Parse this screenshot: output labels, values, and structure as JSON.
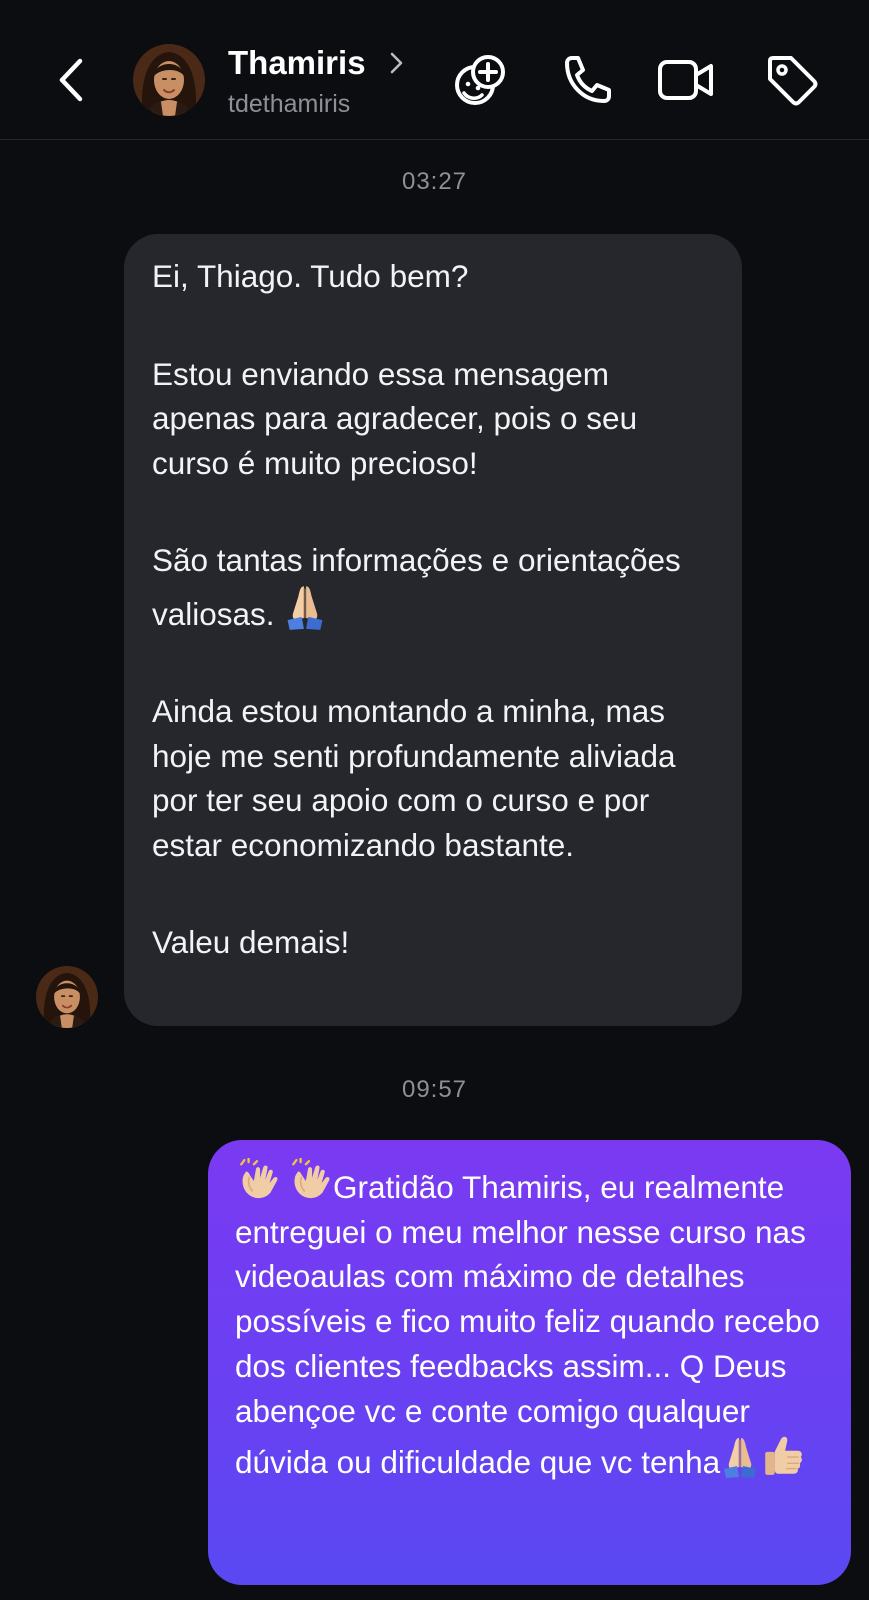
{
  "header": {
    "contact_name": "Thamiris",
    "contact_handle": "tdethamiris",
    "icons": [
      "back-arrow-icon",
      "avatar",
      "chevron-right-icon",
      "sticker-add-icon",
      "phone-icon",
      "video-icon",
      "tag-icon"
    ]
  },
  "conversation": {
    "messages": [
      {
        "timestamp": "03:27",
        "direction": "incoming",
        "paragraphs": [
          "Ei, Thiago.  Tudo bem?",
          "Estou enviando essa mensagem apenas para agradecer, pois o seu curso é muito precioso!",
          "São tantas informações e orientações valiosas.",
          "Ainda estou montando a minha, mas hoje me senti profundamente aliviada por ter seu apoio com o curso e por estar economizando bastante.",
          "Valeu demais!"
        ],
        "emojis": [
          "folded-hands-emoji"
        ]
      },
      {
        "timestamp": "09:57",
        "direction": "outgoing",
        "text": "Gratidão Thamiris, eu realmente entreguei o meu melhor nesse curso nas videoaulas com máximo de detalhes possíveis e fico muito feliz quando recebo dos clientes feedbacks assim... Q Deus abençoe vc e conte comigo qualquer dúvida ou dificuldade que vc tenha",
        "emojis": [
          "clapping-hands-emoji",
          "clapping-hands-emoji",
          "folded-hands-emoji",
          "thumbs-up-emoji"
        ]
      }
    ]
  },
  "colors": {
    "background": "#0c0d10",
    "incoming_bubble": "#25272c",
    "outgoing_gradient_top": "#7a3af2",
    "outgoing_gradient_bottom": "#5a49f2",
    "secondary_text": "#8d9097"
  }
}
